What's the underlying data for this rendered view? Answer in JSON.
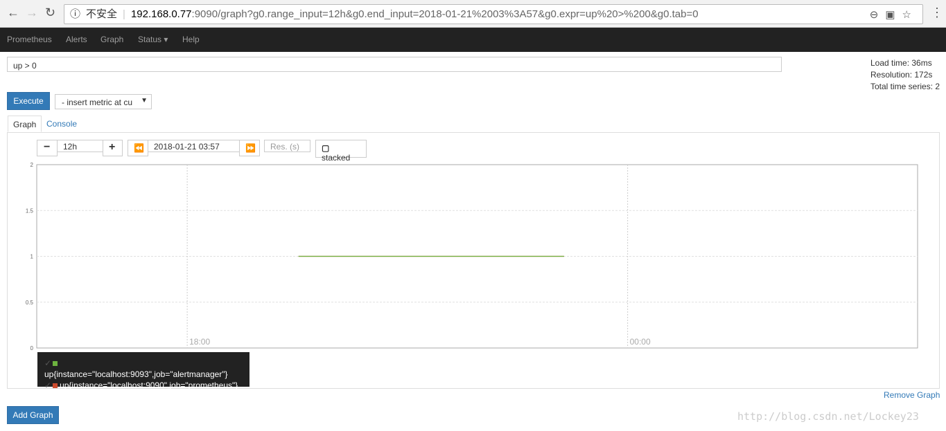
{
  "browser": {
    "security": "不安全",
    "host": "192.168.0.77",
    "url_rest": ":9090/graph?g0.range_input=12h&g0.end_input=2018-01-21%2003%3A57&g0.expr=up%20>%200&g0.tab=0"
  },
  "nav": {
    "brand": "Prometheus",
    "items": [
      "Alerts",
      "Graph",
      "Status ▾",
      "Help"
    ]
  },
  "query": {
    "expression": "up > 0",
    "execute_label": "Execute",
    "metric_select": "- insert metric at cu"
  },
  "stats": {
    "load_time": "Load time: 36ms",
    "resolution": "Resolution: 172s",
    "total_series": "Total time series: 2"
  },
  "tabs": {
    "graph": "Graph",
    "console": "Console"
  },
  "controls": {
    "range": "12h",
    "end_time": "2018-01-21 03:57",
    "resolution_placeholder": "Res. (s)",
    "stacked_label": "stacked"
  },
  "chart_data": {
    "type": "line",
    "x_ticks": [
      "18:00",
      "00:00"
    ],
    "y_ticks": [
      "0",
      "0.5",
      "1",
      "1.5",
      "2"
    ],
    "ylim": [
      0,
      2
    ],
    "xrange": [
      "15:57",
      "03:57"
    ],
    "grid": true,
    "series": [
      {
        "name": "up{instance=\"localhost:9093\",job=\"alertmanager\"}",
        "color": "#6db33f",
        "x": [
          "19:31",
          "23:08"
        ],
        "values": [
          1,
          1
        ]
      },
      {
        "name": "up{instance=\"localhost:9090\",job=\"prometheus\"}",
        "color": "#cb4b2e",
        "x": [
          "19:31",
          "23:08"
        ],
        "values": [
          1,
          1
        ]
      }
    ]
  },
  "remove_graph": "Remove Graph",
  "add_graph": "Add Graph",
  "watermark": "http://blog.csdn.net/Lockey23"
}
